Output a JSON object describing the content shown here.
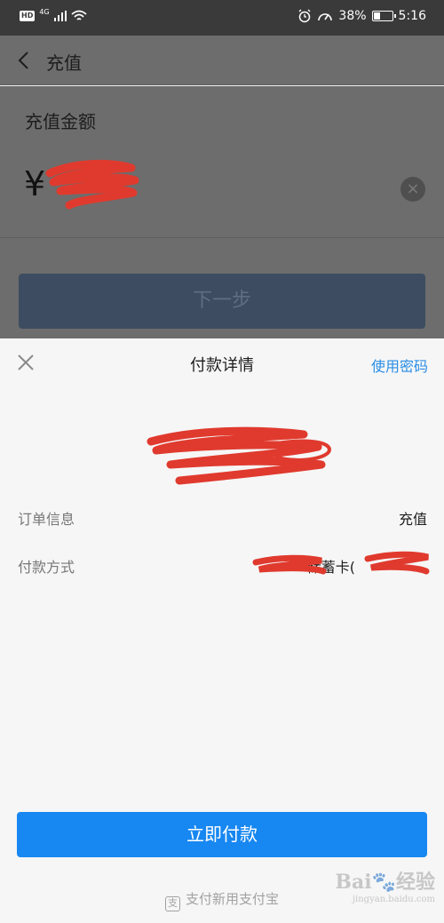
{
  "status_bar": {
    "hd": "HD",
    "network": "4G",
    "battery_percent": "38%",
    "battery_level": 0.38,
    "time": "5:16",
    "icons": [
      "hd-icon",
      "signal-icon",
      "wifi-icon",
      "alarm-icon",
      "speed-icon",
      "battery-icon"
    ]
  },
  "background_page": {
    "title": "充值",
    "amount_label": "充值金额",
    "currency_symbol": "¥",
    "next_button": "下一步"
  },
  "sheet": {
    "title": "付款详情",
    "use_password": "使用密码",
    "order_label": "订单信息",
    "order_value": "充值",
    "payment_label": "付款方式",
    "payment_value": "储蓄卡(",
    "pay_button": "立即付款",
    "footer": "支付新用支付宝"
  },
  "watermark": {
    "brand": "Bai",
    "suffix": "经验",
    "url": "jingyan.baidu.com"
  },
  "colors": {
    "accent": "#1787f1",
    "link": "#2a8ee6",
    "redaction": "#e03a2e",
    "overlay": "#6d6d6d"
  }
}
